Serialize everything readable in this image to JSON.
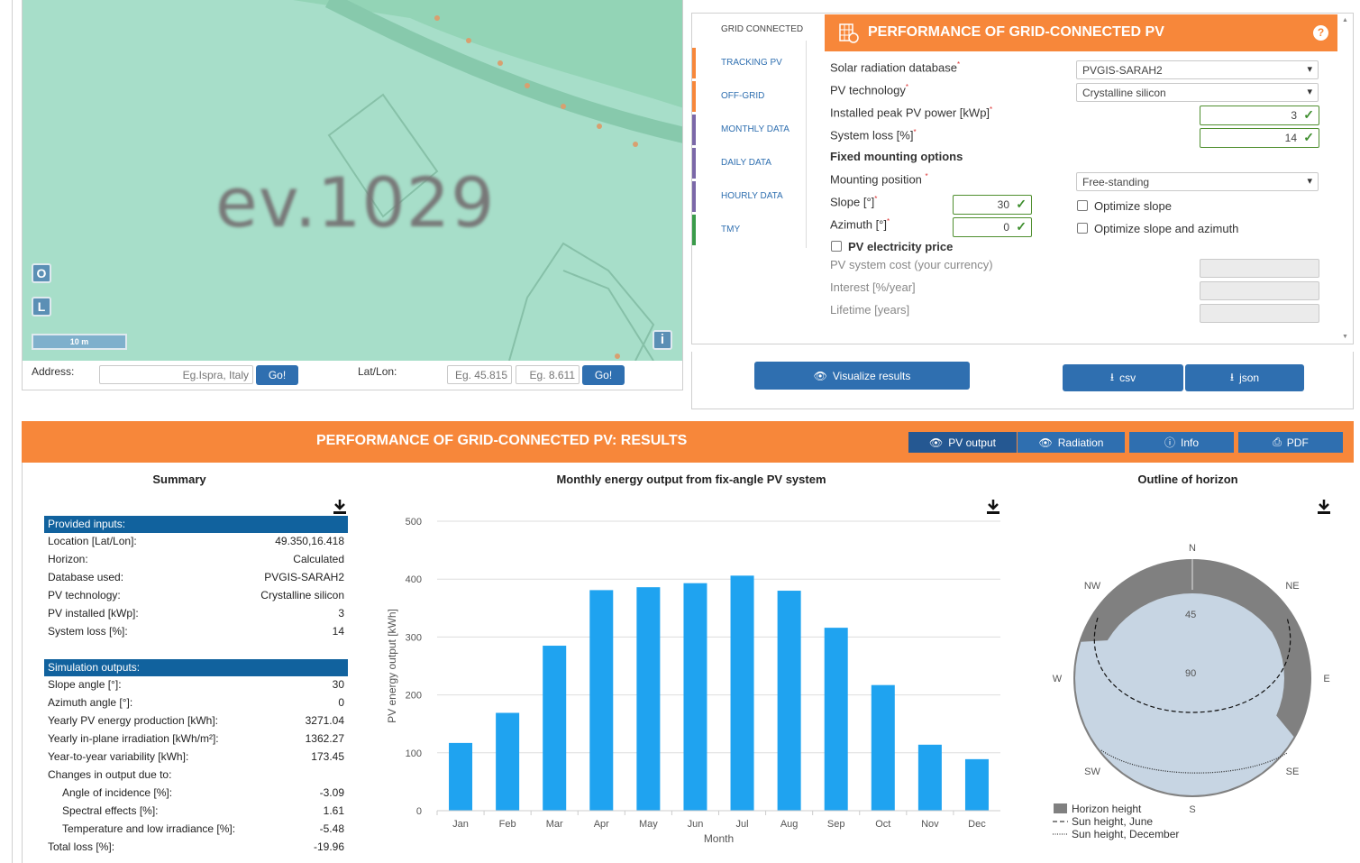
{
  "map": {
    "label": "ev.1029",
    "zoom_buttons": {
      "o": "O",
      "l": "L"
    },
    "scale": "10 m",
    "info": "i"
  },
  "address_bar": {
    "address_label": "Address:",
    "address_placeholder": "Eg.Ispra, Italy",
    "go_label": "Go!",
    "latlon_label": "Lat/Lon:",
    "lat_placeholder": "Eg. 45.815",
    "lon_placeholder": "Eg. 8.611"
  },
  "tabs": [
    {
      "label": "GRID CONNECTED",
      "color": "#ffffff",
      "active": true
    },
    {
      "label": "TRACKING PV",
      "color": "#f7873a",
      "active": false
    },
    {
      "label": "OFF-GRID",
      "color": "#f7873a",
      "active": false
    },
    {
      "label": "MONTHLY DATA",
      "color": "#7b68a8",
      "active": false
    },
    {
      "label": "DAILY DATA",
      "color": "#7b68a8",
      "active": false
    },
    {
      "label": "HOURLY DATA",
      "color": "#7b68a8",
      "active": false
    },
    {
      "label": "TMY",
      "color": "#3a9b4a",
      "active": false
    }
  ],
  "panel": {
    "title": "PERFORMANCE OF GRID-CONNECTED PV",
    "help": "?",
    "solar_db_label": "Solar radiation database",
    "solar_db_value": "PVGIS-SARAH2",
    "pv_tech_label": "PV technology",
    "pv_tech_value": "Crystalline silicon",
    "peak_power_label": "Installed peak PV power [kWp]",
    "peak_power_value": "3",
    "system_loss_label": "System loss [%]",
    "system_loss_value": "14",
    "fixed_mounting_label": "Fixed mounting options",
    "mounting_pos_label": "Mounting position",
    "mounting_pos_value": "Free-standing",
    "slope_label": "Slope [°]",
    "slope_value": "30",
    "azimuth_label": "Azimuth [°]",
    "azimuth_value": "0",
    "optimize_slope_label": "Optimize slope",
    "optimize_both_label": "Optimize slope and azimuth",
    "pv_price_label": "PV electricity price",
    "cost_label": "PV system cost (your currency)",
    "interest_label": "Interest [%/year]",
    "lifetime_label": "Lifetime [years]",
    "required_mark": "*"
  },
  "actions": {
    "visualize": "Visualize results",
    "csv": "csv",
    "json": "json"
  },
  "results": {
    "title": "PERFORMANCE OF GRID-CONNECTED PV: RESULTS",
    "buttons": {
      "pv_output": "PV output",
      "radiation": "Radiation",
      "info": "Info",
      "pdf": "PDF"
    },
    "summary_title": "Summary",
    "inputs_header": "Provided inputs:",
    "inputs": [
      {
        "k": "Location [Lat/Lon]:",
        "v": "49.350,16.418"
      },
      {
        "k": "Horizon:",
        "v": "Calculated"
      },
      {
        "k": "Database used:",
        "v": "PVGIS-SARAH2"
      },
      {
        "k": "PV technology:",
        "v": "Crystalline silicon"
      },
      {
        "k": "PV installed [kWp]:",
        "v": "3"
      },
      {
        "k": "System loss [%]:",
        "v": "14"
      }
    ],
    "outputs_header": "Simulation outputs:",
    "outputs": [
      {
        "k": "Slope angle [°]:",
        "v": "30"
      },
      {
        "k": "Azimuth angle [°]:",
        "v": "0"
      },
      {
        "k": "Yearly PV energy production [kWh]:",
        "v": "3271.04"
      },
      {
        "k": "Yearly in-plane irradiation [kWh/m²]:",
        "v": "1362.27"
      },
      {
        "k": "Year-to-year variability [kWh]:",
        "v": "173.45"
      },
      {
        "k": "Changes in output due to:",
        "v": ""
      },
      {
        "k": "Angle of incidence [%]:",
        "v": "-3.09",
        "indent": true
      },
      {
        "k": "Spectral effects [%]:",
        "v": "1.61",
        "indent": true
      },
      {
        "k": "Temperature and low irradiance [%]:",
        "v": "-5.48",
        "indent": true
      },
      {
        "k": "Total loss [%]:",
        "v": "-19.96"
      }
    ],
    "horizon_title": "Outline of horizon"
  },
  "chart_data": [
    {
      "type": "bar",
      "title": "Monthly energy output from fix-angle PV system",
      "xlabel": "Month",
      "ylabel": "PV energy output [kWh]",
      "categories": [
        "Jan",
        "Feb",
        "Mar",
        "Apr",
        "May",
        "Jun",
        "Jul",
        "Aug",
        "Sep",
        "Oct",
        "Nov",
        "Dec"
      ],
      "values": [
        117,
        169,
        285,
        381,
        386,
        393,
        406,
        380,
        316,
        217,
        114,
        89
      ],
      "ylim": [
        0,
        500
      ],
      "yticks": [
        0,
        100,
        200,
        300,
        400,
        500
      ],
      "color": "#1fa3f0",
      "grid": true
    },
    {
      "type": "polar-horizon",
      "title": "Outline of horizon",
      "directions": [
        "N",
        "NE",
        "E",
        "SE",
        "S",
        "SW",
        "W",
        "NW"
      ],
      "rings": [
        "45",
        "90"
      ],
      "legend": [
        "Horizon height",
        "Sun height, June",
        "Sun height, December"
      ],
      "legend_position": "bottom-left"
    }
  ]
}
